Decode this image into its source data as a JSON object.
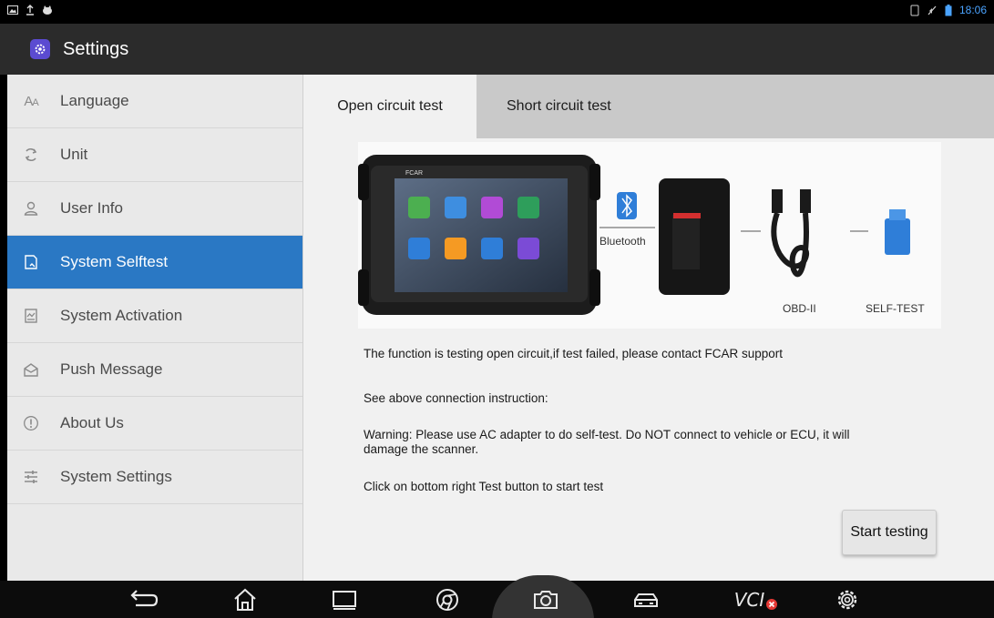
{
  "statusbar": {
    "time": "18:06",
    "left_icons": [
      "image-icon",
      "upload-icon",
      "cat-icon"
    ],
    "right_icons": [
      "sim-icon",
      "mute-icon",
      "battery-icon"
    ]
  },
  "header": {
    "title": "Settings",
    "icon": "settings-gear-icon"
  },
  "sidebar": {
    "items": [
      {
        "label": "Language",
        "icon": "language-icon",
        "active": false
      },
      {
        "label": "Unit",
        "icon": "unit-icon",
        "active": false
      },
      {
        "label": "User Info",
        "icon": "user-icon",
        "active": false
      },
      {
        "label": "System Selftest",
        "icon": "selftest-icon",
        "active": true
      },
      {
        "label": "System Activation",
        "icon": "activation-icon",
        "active": false
      },
      {
        "label": "Push Message",
        "icon": "message-icon",
        "active": false
      },
      {
        "label": "About Us",
        "icon": "info-icon",
        "active": false
      },
      {
        "label": "System Settings",
        "icon": "sliders-icon",
        "active": false
      }
    ]
  },
  "main": {
    "tabs": [
      {
        "label": "Open circuit test",
        "active": true
      },
      {
        "label": "Short circuit test",
        "active": false
      }
    ],
    "diagram": {
      "brand": "FCAR",
      "bluetooth_label": "Bluetooth",
      "obd_label": "OBD-II",
      "selftest_label": "SELF-TEST"
    },
    "instructions": {
      "line1": "The function is testing open circuit,if test failed, please contact FCAR support",
      "line2": "See above connection instruction:",
      "line3a": "Warning: Please use AC adapter to do self-test. Do NOT connect to vehicle or ECU, it will",
      "line3b": "damage the scanner.",
      "line4": "Click on bottom right Test button to start test"
    },
    "start_button": "Start testing"
  },
  "navbar": {
    "items": [
      "back-icon",
      "home-icon",
      "recents-icon",
      "browser-icon",
      "camera-icon",
      "car-icon",
      "vci-icon",
      "settings-icon"
    ],
    "vci_label": "VCI"
  },
  "colors": {
    "accent": "#2a78c4",
    "titlebar": "#2b2b2b",
    "tab_inactive": "#c9c9c9",
    "vci_error": "#e53935"
  }
}
